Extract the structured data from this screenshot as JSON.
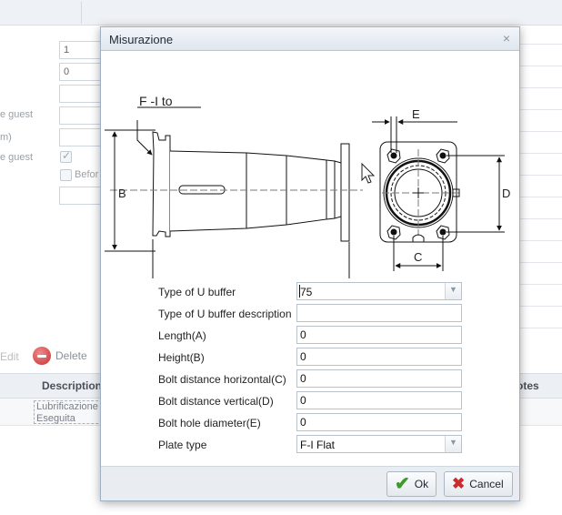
{
  "background": {
    "fields": [
      "1",
      "0"
    ],
    "labels": [
      "e guest",
      "m)",
      "e guest",
      "Befor"
    ],
    "toolbar": {
      "edit_label": "Edit",
      "delete_label": "Delete"
    },
    "grid": {
      "headers": [
        "Description",
        "otes"
      ],
      "cell_lines": [
        "Lubrificazione",
        "Eseguita"
      ]
    }
  },
  "dialog": {
    "title": "Misurazione",
    "close_icon": "×",
    "drawing": {
      "caption": "F -I to",
      "dimension_labels": [
        "A",
        "B",
        "C",
        "D",
        "E"
      ]
    },
    "fields": [
      {
        "label": "Type of U buffer",
        "value": "75",
        "kind": "combo"
      },
      {
        "label": "Type of U buffer description",
        "value": "",
        "kind": "text"
      },
      {
        "label": "Length(A)",
        "value": "0",
        "kind": "text"
      },
      {
        "label": "Height(B)",
        "value": "0",
        "kind": "text"
      },
      {
        "label": "Bolt distance horizontal(C)",
        "value": "0",
        "kind": "text"
      },
      {
        "label": "Bolt distance vertical(D)",
        "value": "0",
        "kind": "text"
      },
      {
        "label": "Bolt hole diameter(E)",
        "value": "0",
        "kind": "text"
      },
      {
        "label": "Plate type",
        "value": "F-I Flat",
        "kind": "combo"
      }
    ],
    "buttons": {
      "ok": "Ok",
      "cancel": "Cancel"
    }
  }
}
